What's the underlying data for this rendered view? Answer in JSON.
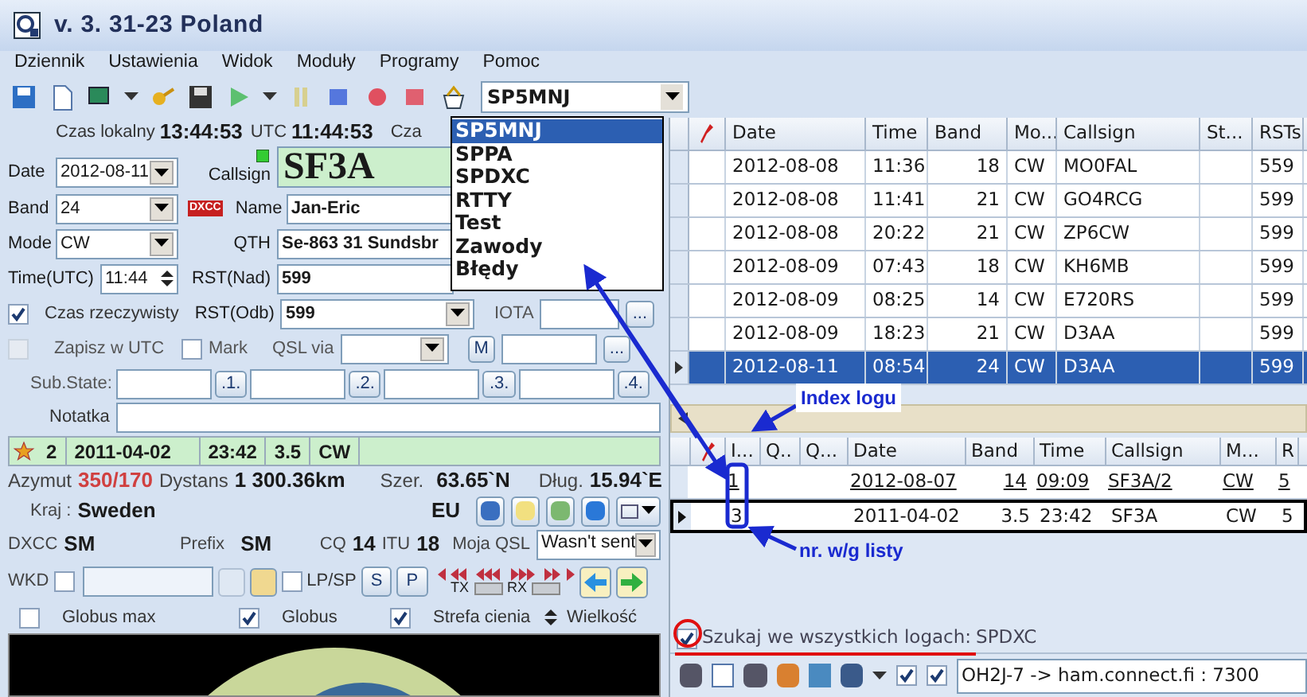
{
  "window": {
    "title": "v. 3. 31-23 Poland"
  },
  "menu": [
    "Dziennik",
    "Ustawienia",
    "Widok",
    "Moduły",
    "Programy",
    "Pomoc"
  ],
  "log_select": {
    "value": "SP5MNJ",
    "expanded": true,
    "options": [
      {
        "label": "SP5MNJ",
        "selected": true
      },
      {
        "label": "SPPA",
        "selected": false
      },
      {
        "label": "SPDXC",
        "selected": false
      },
      {
        "label": "RTTY",
        "selected": false
      },
      {
        "label": "Test",
        "selected": false
      },
      {
        "label": "Zawody",
        "selected": false
      },
      {
        "label": "Błędy",
        "selected": false
      }
    ]
  },
  "clock": {
    "local_label": "Czas lokalny",
    "local_time": "13:44:53",
    "utc_label": "UTC",
    "utc_time": "11:44:53",
    "third_label": "Cza"
  },
  "qso_form": {
    "date_label": "Date",
    "date": "2012-08-11",
    "band_label": "Band",
    "band": "24",
    "mode_label": "Mode",
    "mode": "CW",
    "time_label": "Time(UTC)",
    "time": "11:44",
    "callsign_label": "Callsign",
    "callsign": "SF3A",
    "dxcc_badge": "DXCC",
    "name_label": "Name",
    "name": "Jan-Eric",
    "qth_label": "QTH",
    "qth": "Se-863 31 Sundsbr",
    "rst_sent_label": "RST(Nad)",
    "rst_sent": "599",
    "rst_rcvd_label": "RST(Odb)",
    "rst_rcvd": "599",
    "iota_label": "IOTA",
    "more_button": "...",
    "qsl_via_label": "QSL via",
    "m_button": "M",
    "sub_state_label": "Sub.State:",
    "sub_buttons": [
      ".1.",
      ".2.",
      ".3.",
      ".4."
    ],
    "note_label": "Notatka"
  },
  "realtime": {
    "label": "Czas rzeczywisty",
    "checked": true
  },
  "save_utc": {
    "label": "Zapisz w UTC",
    "checked": false,
    "disabled": true
  },
  "mark": {
    "label": "Mark",
    "checked": false
  },
  "last_qso": [
    "2",
    "2011-04-02",
    "23:42",
    "3.5",
    "CW"
  ],
  "info": {
    "azimuth_label": "Azymut",
    "azimuth": "350/170",
    "distance_label": "Dystans",
    "distance": "1 300.36km",
    "lat_label": "Szer.",
    "lat": "63.65`N",
    "lon_label": "Dług.",
    "lon": "15.94`E",
    "country_label": "Kraj :",
    "country": "Sweden",
    "continent": "EU",
    "dxcc_label": "DXCC",
    "dxcc": "SM",
    "prefix_label": "Prefix",
    "prefix": "SM",
    "cq_label": "CQ",
    "cq": "14",
    "itu_label": "ITU",
    "itu": "18",
    "my_qsl_label": "Moja QSL",
    "my_qsl": "Wasn't sent"
  },
  "wkd": {
    "label": "WKD",
    "checked": false,
    "lpsp_label": "LP/SP",
    "lpsp_checked": false,
    "s_button": "S",
    "p_button": "P",
    "tx_label": "TX",
    "rx_label": "RX"
  },
  "globe_options": [
    {
      "label": "Globus max",
      "checked": false
    },
    {
      "label": "Globus",
      "checked": true
    },
    {
      "label": "Strefa cienia",
      "checked": true
    }
  ],
  "size_label": "Wielkość",
  "log_table": {
    "columns": [
      "Date",
      "Time",
      "Band",
      "Mo...",
      "Callsign",
      "St...",
      "RSTs"
    ],
    "rows": [
      {
        "cells": [
          "2012-08-08",
          "11:36",
          "18",
          "CW",
          "MO0FAL",
          "",
          "559"
        ],
        "selected": false
      },
      {
        "cells": [
          "2012-08-08",
          "11:41",
          "21",
          "CW",
          "GO4RCG",
          "",
          "599"
        ],
        "selected": false
      },
      {
        "cells": [
          "2012-08-08",
          "20:22",
          "21",
          "CW",
          "ZP6CW",
          "",
          "599"
        ],
        "selected": false
      },
      {
        "cells": [
          "2012-08-09",
          "07:43",
          "18",
          "CW",
          "KH6MB",
          "",
          "599"
        ],
        "selected": false
      },
      {
        "cells": [
          "2012-08-09",
          "08:25",
          "14",
          "CW",
          "E720RS",
          "",
          "599"
        ],
        "selected": false
      },
      {
        "cells": [
          "2012-08-09",
          "18:23",
          "21",
          "CW",
          "D3AA",
          "",
          "599"
        ],
        "selected": false
      },
      {
        "cells": [
          "2012-08-11",
          "08:54",
          "24",
          "CW",
          "D3AA",
          "",
          "599"
        ],
        "selected": true
      }
    ]
  },
  "search_table": {
    "columns": [
      "I...",
      "Q..",
      "Q...",
      "Date",
      "Band",
      "Time",
      "Callsign",
      "M...",
      "R"
    ],
    "rows": [
      {
        "cells": [
          "1",
          "",
          "",
          "2012-08-07",
          "14",
          "09:09",
          "SF3A/2",
          "CW",
          "5"
        ],
        "selected": false,
        "underlined": true
      },
      {
        "cells": [
          "3",
          "",
          "",
          "2011-04-02",
          "3.5",
          "23:42",
          "SF3A",
          "CW",
          "5"
        ],
        "selected": true,
        "underlined": false
      }
    ]
  },
  "search_all": {
    "label": "Szukaj we wszystkich logach:",
    "value": "SPDXC",
    "checked": true
  },
  "connection": {
    "checks": [
      true,
      true
    ],
    "value": "OH2J-7 -> ham.connect.fi : 7300"
  },
  "annotations": [
    "Index logu",
    "nr. w/g listy"
  ]
}
